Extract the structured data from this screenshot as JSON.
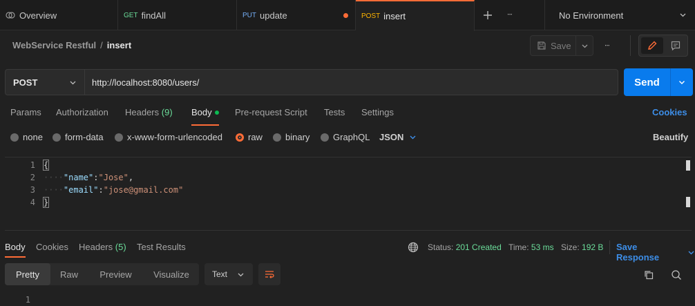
{
  "tabs": [
    {
      "method": "",
      "label": "Overview"
    },
    {
      "method": "GET",
      "label": "findAll"
    },
    {
      "method": "PUT",
      "label": "update"
    },
    {
      "method": "POST",
      "label": "insert"
    }
  ],
  "tabs_more": "∙∙∙",
  "environment": "No Environment",
  "breadcrumb": {
    "collection": "WebService Restful",
    "separator": "/",
    "request": "insert"
  },
  "toolbar": {
    "save_label": "Save",
    "more": "∙∙∙"
  },
  "request": {
    "method": "POST",
    "url": "http://localhost:8080/users/"
  },
  "send_label": "Send",
  "request_tabs": {
    "params": "Params",
    "authorization": "Authorization",
    "headers": "Headers",
    "headers_count": "(9)",
    "body": "Body",
    "prerequest": "Pre-request Script",
    "tests": "Tests",
    "settings": "Settings",
    "cookies": "Cookies"
  },
  "body_types": {
    "none": "none",
    "form_data": "form-data",
    "urlencoded": "x-www-form-urlencoded",
    "raw": "raw",
    "binary": "binary",
    "graphql": "GraphQL",
    "format": "JSON",
    "beautify": "Beautify"
  },
  "editor": {
    "line_numbers": [
      "1",
      "2",
      "3",
      "4"
    ],
    "open_brace": "{",
    "close_brace": "}",
    "lines": [
      {
        "key": "\"name\"",
        "colon": ":",
        "value": "\"Jose\"",
        "trail": ","
      },
      {
        "key": "\"email\"",
        "colon": ":",
        "value": "\"jose@gmail.com\"",
        "trail": ""
      }
    ],
    "indent": "····"
  },
  "response": {
    "tabs": {
      "body": "Body",
      "cookies": "Cookies",
      "headers": "Headers",
      "headers_count": "(5)",
      "tests": "Test Results"
    },
    "status_label": "Status:",
    "status_value": "201 Created",
    "time_label": "Time:",
    "time_value": "53 ms",
    "size_label": "Size:",
    "size_value": "192 B",
    "save_response": "Save Response",
    "view_modes": {
      "pretty": "Pretty",
      "raw": "Raw",
      "preview": "Preview",
      "visualize": "Visualize"
    },
    "format": "Text",
    "line_numbers": [
      "1"
    ]
  },
  "colors": {
    "accent": "#ff6c37",
    "send": "#097bed",
    "link": "#3d8ee8",
    "success": "#6bdd9a"
  }
}
